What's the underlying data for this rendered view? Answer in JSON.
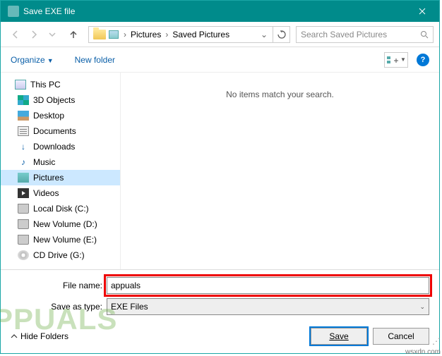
{
  "titlebar": {
    "title": "Save EXE file"
  },
  "nav": {
    "crumbs": [
      "Pictures",
      "Saved Pictures"
    ],
    "search_placeholder": "Search Saved Pictures"
  },
  "toolbar": {
    "organize": "Organize",
    "new_folder": "New folder"
  },
  "tree": {
    "root": "This PC",
    "items": [
      "3D Objects",
      "Desktop",
      "Documents",
      "Downloads",
      "Music",
      "Pictures",
      "Videos",
      "Local Disk (C:)",
      "New Volume (D:)",
      "New Volume (E:)",
      "CD Drive (G:)"
    ],
    "selected_index": 5
  },
  "content": {
    "empty_msg": "No items match your search."
  },
  "bottom": {
    "filename_label": "File name:",
    "filename_value": "appuals",
    "type_label": "Save as type:",
    "type_value": "EXE Files",
    "hide_folders": "Hide Folders",
    "save": "Save",
    "cancel": "Cancel"
  },
  "watermark": "PPUALS",
  "source": "wsxdn.com"
}
